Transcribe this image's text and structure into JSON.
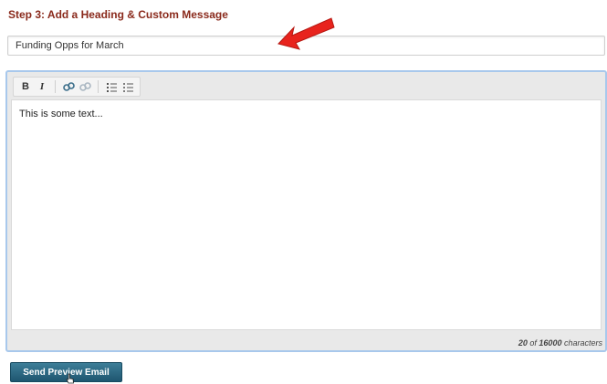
{
  "step": {
    "title": "Step 3: Add a Heading & Custom Message"
  },
  "heading_field": {
    "value": "Funding Opps for March"
  },
  "toolbar": {
    "bold_label": "B",
    "italic_label": "I",
    "icons": [
      "bold-icon",
      "italic-icon",
      "link-icon",
      "unlink-icon",
      "ordered-list-icon",
      "unordered-list-icon"
    ]
  },
  "editor": {
    "content": "This is some text...",
    "count_current": "20",
    "count_of": "of",
    "count_max": "16000",
    "count_unit": "characters"
  },
  "actions": {
    "send_preview_label": "Send Preview Email"
  },
  "colors": {
    "title": "#8a2a1c",
    "editor_border": "#a8c8ec",
    "button": "#1f5670",
    "arrow": "#e8231d"
  }
}
